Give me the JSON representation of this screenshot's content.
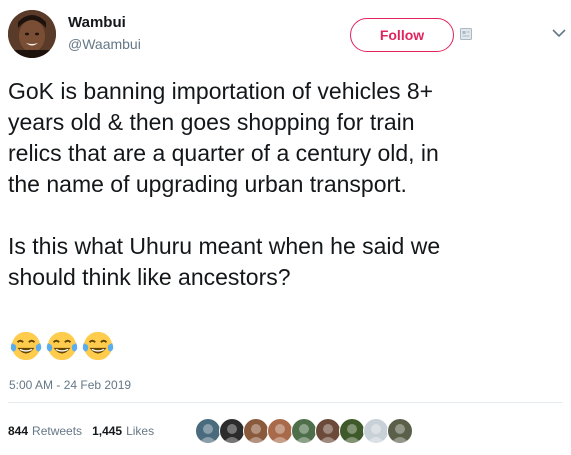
{
  "author": {
    "display_name": "Wambui",
    "handle": "@Waambui"
  },
  "follow_button": {
    "label": "Follow",
    "color": "#e0245e"
  },
  "tweet": {
    "text": "GoK is banning importation of vehicles 8+\nyears old & then goes shopping for train\nrelics that are a quarter of a century old, in\nthe name of upgrading urban transport.\n\nIs this what Uhuru meant when he said we\nshould think like ancestors?",
    "emojis": [
      "face-with-tears-of-joy",
      "face-with-tears-of-joy",
      "face-with-tears-of-joy"
    ],
    "timestamp": "5:00 AM - 24 Feb 2019"
  },
  "stats": {
    "retweets_count": "844",
    "retweets_label": "Retweets",
    "likes_count": "1,445",
    "likes_label": "Likes"
  },
  "likers": [
    {
      "icon": "user-avatar-icon",
      "color": "#4a6b7d"
    },
    {
      "icon": "user-avatar-icon",
      "color": "#2c2c2c"
    },
    {
      "icon": "user-avatar-icon",
      "color": "#8a5a3c"
    },
    {
      "icon": "user-avatar-icon",
      "color": "#a86a4a"
    },
    {
      "icon": "user-avatar-icon",
      "color": "#4f6f4a"
    },
    {
      "icon": "user-avatar-icon",
      "color": "#6b4a3a"
    },
    {
      "icon": "user-avatar-icon",
      "color": "#3f5a2a"
    },
    {
      "icon": "user-avatar-icon",
      "color": "#c8d1d8"
    },
    {
      "icon": "user-avatar-icon",
      "color": "#5a5f4a"
    }
  ]
}
